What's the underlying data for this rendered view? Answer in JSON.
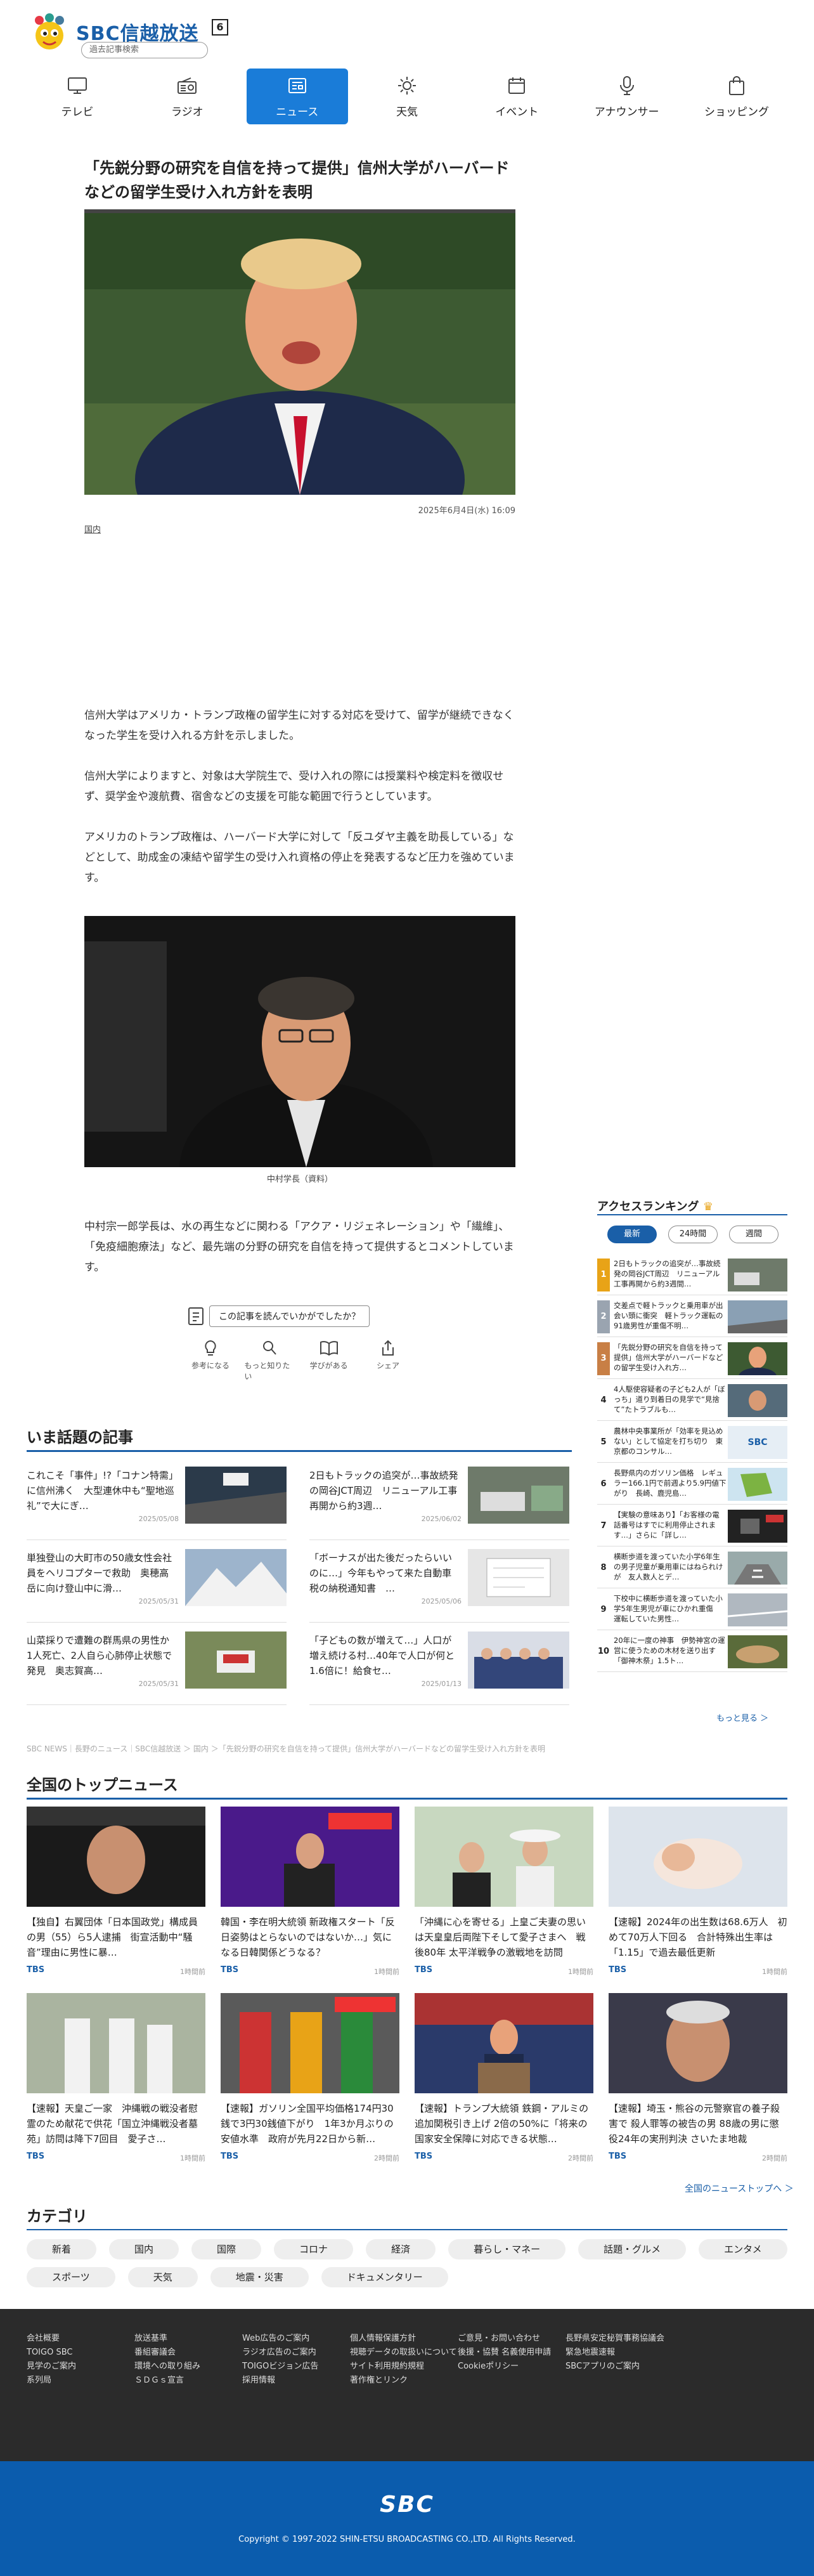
{
  "header": {
    "logo_text": "SBC信越放送",
    "channel": "6",
    "search_placeholder": "過去記事検索"
  },
  "nav": [
    {
      "label": "テレビ",
      "icon": "tv-icon"
    },
    {
      "label": "ラジオ",
      "icon": "radio-icon"
    },
    {
      "label": "ニュース",
      "icon": "news-icon",
      "active": true
    },
    {
      "label": "天気",
      "icon": "sun-icon"
    },
    {
      "label": "イベント",
      "icon": "calendar-icon"
    },
    {
      "label": "アナウンサー",
      "icon": "microphone-icon"
    },
    {
      "label": "ショッピング",
      "icon": "shopping-bag-icon"
    }
  ],
  "article": {
    "headline": "「先鋭分野の研究を自信を持って提供」信州大学がハーバードなどの留学生受け入れ方針を表明",
    "date": "2025年6月4日(水) 16:09",
    "category": "国内",
    "p1": "信州大学はアメリカ・トランプ政権の留学生に対する対応を受けて、留学が継続できなくなった学生を受け入れる方針を示しました。",
    "p2": "信州大学によりますと、対象は大学院生で、受け入れの際には授業料や検定料を徴収せず、奨学金や渡航費、宿舎などの支援を可能な範囲で行うとしています。",
    "p3": "アメリカのトランプ政権は、ハーバード大学に対して「反ユダヤ主義を助長している」などとして、助成金の凍結や留学生の受け入れ資格の停止を発表するなど圧力を強めています。",
    "caption": "中村学長（資料）",
    "p4": "中村宗一郎学長は、水の再生などに関わる「アクア・リジェネレーション」や「繊維」、「免疫細胞療法」など、最先端の分野の研究を自信を持って提供するとコメントしています。"
  },
  "feedback": {
    "question": "この記事を読んでいかがでしたか？",
    "buttons": [
      {
        "label": "参考になる",
        "icon": "lightbulb-icon"
      },
      {
        "label": "もっと知りたい",
        "icon": "magnifier-icon"
      },
      {
        "label": "学びがある",
        "icon": "book-icon"
      },
      {
        "label": "シェア",
        "icon": "share-icon"
      }
    ]
  },
  "topics": {
    "title": "いま話題の記事",
    "items": [
      {
        "title": "これこそ「事件」!?「コナン特需」に信州沸く　大型連休中も“聖地巡礼”で大にぎ…",
        "date": "2025/05/08"
      },
      {
        "title": "2日もトラックの追突が…事故続発の岡谷JCT周辺　リニューアル工事再開から約3週…",
        "date": "2025/06/02"
      },
      {
        "title": "単独登山の大町市の50歳女性会社員をヘリコプターで救助　奥穂高岳に向け登山中に滑…",
        "date": "2025/05/31"
      },
      {
        "title": "「ボーナスが出た後だったらいいのに…」今年もやって来た自動車税の納税通知書　…",
        "date": "2025/05/06"
      },
      {
        "title": "山菜採りで遭難の群馬県の男性か　1人死亡、2人自ら心肺停止状態で発見　奥志賀高…",
        "date": "2025/05/31"
      },
      {
        "title": "「子どもの数が増えて…」人口が増え続ける村…40年で人口が何と1.6倍に！給食セ…",
        "date": "2025/01/13"
      }
    ]
  },
  "ranking": {
    "title": "アクセスランキング",
    "tabs": [
      "最新",
      "24時間",
      "週間"
    ],
    "items": [
      {
        "num": "1",
        "title": "2日もトラックの追突が…事故続発の岡谷JCT周辺　リニューアル工事再開から約3週間…"
      },
      {
        "num": "2",
        "title": "交差点で軽トラックと乗用車が出会い頭に衝突　軽トラック運転の91歳男性が重傷不明…"
      },
      {
        "num": "3",
        "title": "「先鋭分野の研究を自信を持って提供」信州大学がハーバードなどの留学生受け入れ方…"
      },
      {
        "num": "4",
        "title": "4人駆使容疑者の子ども2人が「ぼっち」道り到着日の見学で“見捨て”たトラブルも…"
      },
      {
        "num": "5",
        "title": "農林中央事業所が「効率を見込めない」として協定を打ち切り　東京都のコンサル…"
      },
      {
        "num": "6",
        "title": "長野県内のガソリン価格　レギュラー166.1円で前週より5.9円値下がり　長崎、鹿児島…"
      },
      {
        "num": "7",
        "title": "【実験の意味あり】「お客様の電話番号はすでに利用停止されます…」さらに「詳し…"
      },
      {
        "num": "8",
        "title": "横断歩道を渡っていた小学6年生の男子児童が乗用車にはねられけが　友人数人とデ…"
      },
      {
        "num": "9",
        "title": "下校中に横断歩道を渡っていた小学5年生男児が車にひかれ重傷　運転していた男性…"
      },
      {
        "num": "10",
        "title": "20年に一度の神事　伊勢神宮の運営に使うための木材を送り出す「御神木祭」1.5ト…"
      }
    ],
    "more": "もっと見る ＞"
  },
  "breadcrumb": "SBC NEWS｜長野のニュース｜SBC信越放送 ＞ 国内 ＞「先鋭分野の研究を自信を持って提供」信州大学がハーバードなどの留学生受け入れ方針を表明",
  "national": {
    "title": "全国のトップニュース",
    "items": [
      {
        "title": "【独自】右翼団体「日本国政党」構成員の男（55）ら5人逮捕　街宣活動中“騒音”理由に男性に暴…",
        "source": "TBS",
        "time": "1時間前"
      },
      {
        "title": "韓国・李在明大統領 新政権スタート「反日姿勢はとらないのではないか…」気になる日韓関係どうなる？",
        "source": "TBS",
        "time": "1時間前"
      },
      {
        "title": "「沖縄に心を寄せる」上皇ご夫妻の思いは天皇皇后両陛下そして愛子さまへ　戦後80年 太平洋戦争の激戦地を訪問",
        "source": "TBS",
        "time": "1時間前"
      },
      {
        "title": "【速報】2024年の出生数は68.6万人　初めて70万人下回る　合計特殊出生率は「1.15」で過去最低更新",
        "source": "TBS",
        "time": "1時間前"
      },
      {
        "title": "【速報】天皇ご一家　沖縄戦の戦没者慰霊のため献花で供花「国立沖縄戦没者墓苑」訪問は降下7回目　愛子さ…",
        "source": "TBS",
        "time": "1時間前"
      },
      {
        "title": "【速報】ガソリン全国平均価格174円30銭で3円30銭値下がり　1年3か月ぶりの安値水準　政府が先月22日から新…",
        "source": "TBS",
        "time": "2時間前"
      },
      {
        "title": "【速報】トランプ大統領 鉄鋼・アルミの追加関税引き上げ 2倍の50%に「将来の国家安全保障に対応できる状態…",
        "source": "TBS",
        "time": "2時間前"
      },
      {
        "title": "【速報】埼玉・熊谷の元警察官の養子殺害で 殺人罪等の被告の男 88歳の男に懲役24年の実刑判決 さいたま地裁",
        "source": "TBS",
        "time": "2時間前"
      }
    ],
    "more": "全国のニューストップへ ＞"
  },
  "categories": {
    "title": "カテゴリ",
    "items": [
      "新着",
      "国内",
      "国際",
      "コロナ",
      "経済",
      "暮らし・マネー",
      "話題・グルメ",
      "エンタメ",
      "スポーツ",
      "天気",
      "地震・災害",
      "ドキュメンタリー"
    ]
  },
  "footer": {
    "cols": [
      [
        "会社概要",
        "TOIGO SBC",
        "見学のご案内",
        "系列局"
      ],
      [
        "放送基準",
        "番組審議会",
        "環境への取り組み",
        "ＳＤＧｓ宣言"
      ],
      [
        "Web広告のご案内",
        "ラジオ広告のご案内",
        "TOIGOビジョン広告",
        "採用情報"
      ],
      [
        "個人情報保護方針",
        "視聴データの取扱いについて",
        "サイト利用規約規程",
        "著作権とリンク"
      ],
      [
        "ご意見・お問い合わせ",
        "後援・協賛 名義使用申請",
        "Cookieポリシー"
      ],
      [
        "長野県安定秘賀事務協議会",
        "緊急地震速報",
        "SBCアプリのご案内"
      ]
    ],
    "logo": "SBC",
    "copyright": "Copyright © 1997-2022 SHIN-ETSU BROADCASTING CO.,LTD. All Rights Reserved."
  },
  "colors": {
    "accent": "#1a7cd8",
    "section_line": "#1a5fa8",
    "footer": "#2b2b2b",
    "footer_blue": "#0b5cad"
  }
}
